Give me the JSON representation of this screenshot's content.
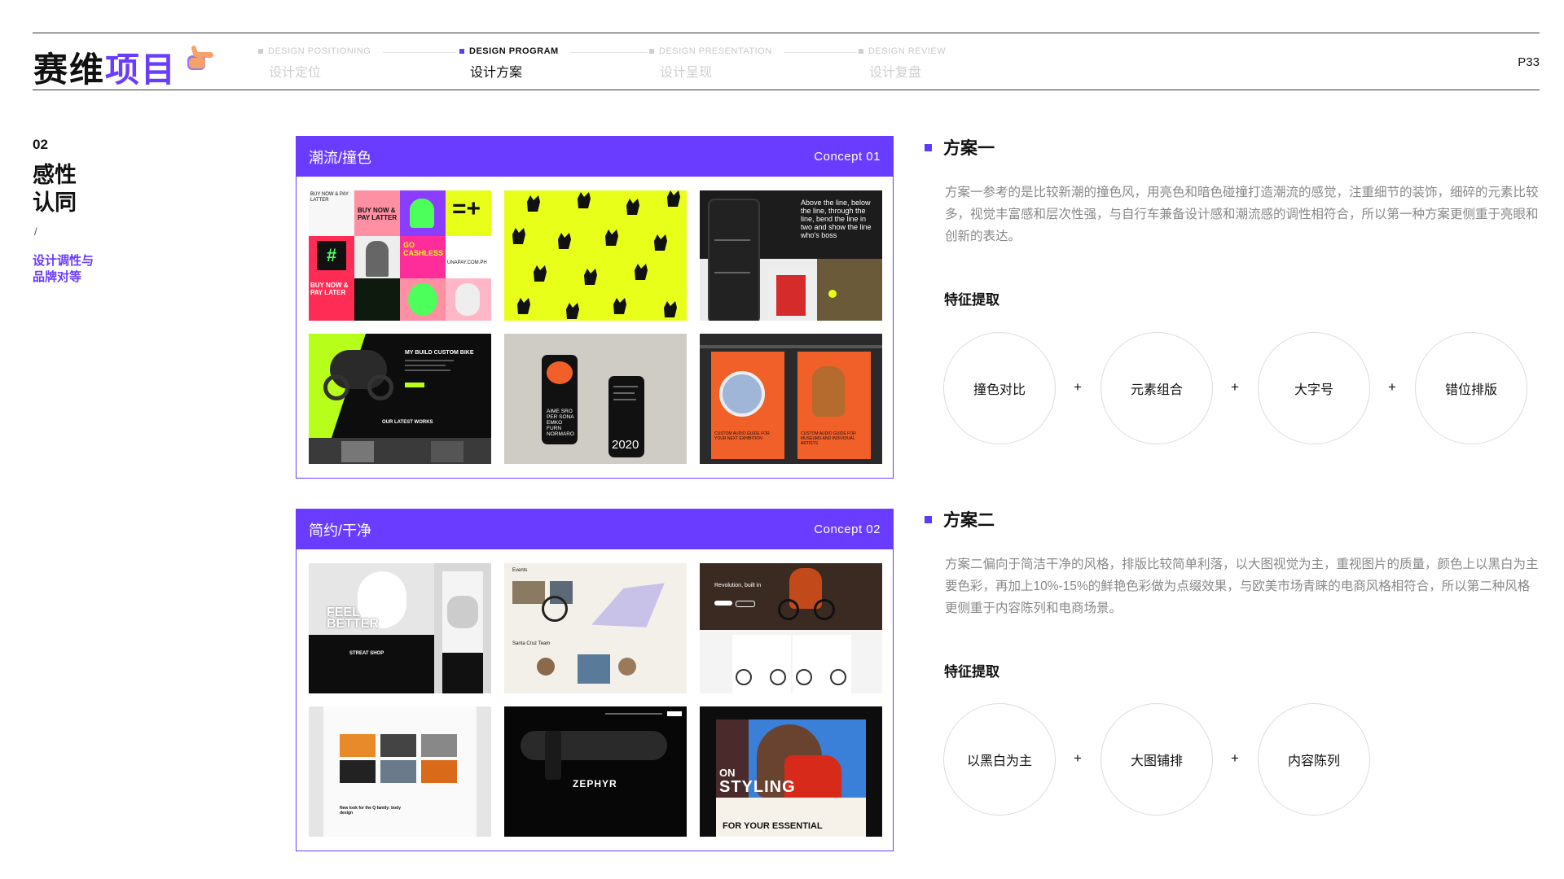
{
  "header": {
    "brand_part1": "赛维",
    "brand_part2": "项目",
    "steps": [
      {
        "en": "DESIGN POSITIONING",
        "cn": "设计定位"
      },
      {
        "en": "DESIGN PROGRAM",
        "cn": "设计方案"
      },
      {
        "en": "DESIGN PRESENTATION",
        "cn": "设计呈现"
      },
      {
        "en": "DESIGN REVIEW",
        "cn": "设计复盘"
      }
    ],
    "page_number": "P33"
  },
  "section": {
    "number": "02",
    "title_line1": "感性",
    "title_line2": "认同",
    "slash": "/",
    "subtitle_line1": "设计调性与",
    "subtitle_line2": "品牌对等"
  },
  "concept1": {
    "title": "潮流/撞色",
    "tag": "Concept 01",
    "thumb_texts": {
      "t1_a": "BUY NOW & PAY LATTER",
      "t1_b": "GO CASHLESS",
      "t1_c": "UNAPAY.COM.PH",
      "t1_d": "BUY NOW & PAY LATER",
      "t3_a": "Above the line, below the line, through the line, bend the line in two and show the line who's boss",
      "t4_a": "MY BUILD CUSTOM BIKE",
      "t4_b": "OUR LATEST WORKS",
      "t5_a": "AIME SRO PER SONA EMKO FURN NORMARO",
      "t5_b": "2020",
      "t6_a": "CUSTOM AUDIO GUIDE FOR YOUR NEXT EXHIBITION",
      "t6_b": "CUSTOM AUDIO GUIDE FOR MUSEUMS AND INDIVIDUAL ARTISTS"
    }
  },
  "concept2": {
    "title": "简约/干净",
    "tag": "Concept 02",
    "thumb_texts": {
      "t1_a": "FEEL BETTER",
      "t1_b": "STREAT SHOP",
      "t2_a": "Events",
      "t2_b": "Santa Cruz Team",
      "t3_a": "Revolution, built in",
      "t4_a": "New look for the Q family: body design",
      "t5_a": "ZEPHYR",
      "t6_a": "ON",
      "t6_b": "STYLING",
      "t6_c": "FOR YOUR ESSENTIAL"
    }
  },
  "plan1": {
    "title": "方案一",
    "paragraph": "方案一参考的是比较新潮的撞色风，用亮色和暗色碰撞打造潮流的感觉，注重细节的装饰，细碎的元素比较多，视觉丰富感和层次性强，与自行车兼备设计感和潮流感的调性相符合，所以第一种方案更侧重于亮眼和创新的表达。",
    "feature_title": "特征提取",
    "features": [
      "撞色对比",
      "元素组合",
      "大字号",
      "错位排版"
    ],
    "plus": "+"
  },
  "plan2": {
    "title": "方案二",
    "paragraph": "方案二偏向于简洁干净的风格，排版比较简单利落，以大图视觉为主，重视图片的质量，颜色上以黑白为主要色彩，再加上10%-15%的鲜艳色彩做为点缀效果，与欧美市场青睐的电商风格相符合，所以第二种风格更侧重于内容陈列和电商场景。",
    "feature_title": "特征提取",
    "features": [
      "以黑白为主",
      "大图铺排",
      "内容陈列"
    ],
    "plus": "+"
  },
  "colors": {
    "accent": "#6a3cff",
    "neon": "#e8ff1a",
    "orange": "#f2602a"
  }
}
